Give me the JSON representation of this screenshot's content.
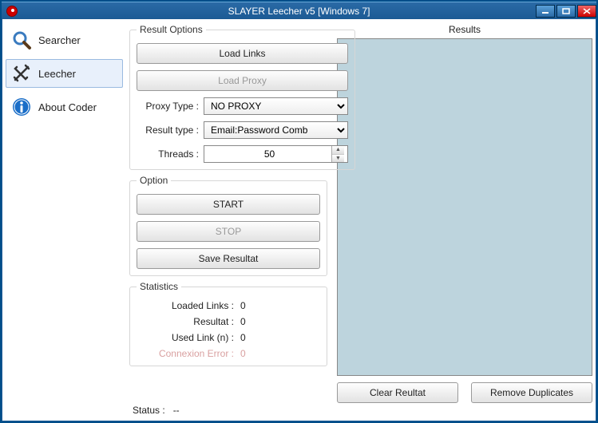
{
  "window": {
    "title": "SLAYER Leecher v5 [Windows 7]"
  },
  "sidebar": {
    "items": [
      {
        "label": "Searcher"
      },
      {
        "label": "Leecher"
      },
      {
        "label": "About Coder"
      }
    ]
  },
  "resultOptions": {
    "legend": "Result Options",
    "loadLinks": "Load Links",
    "loadProxy": "Load Proxy",
    "proxyTypeLabel": "Proxy Type :",
    "proxyTypeValue": "NO PROXY",
    "resultTypeLabel": "Result type :",
    "resultTypeValue": "Email:Password Comb",
    "threadsLabel": "Threads :",
    "threadsValue": "50"
  },
  "option": {
    "legend": "Option",
    "start": "START",
    "stop": "STOP",
    "save": "Save Resultat"
  },
  "statistics": {
    "legend": "Statistics",
    "loadedLinksLabel": "Loaded Links :",
    "loadedLinksValue": "0",
    "resultatLabel": "Resultat :",
    "resultatValue": "0",
    "usedLinkLabel": "Used Link (n) :",
    "usedLinkValue": "0",
    "connErrorLabel": "Connexion Error :",
    "connErrorValue": "0"
  },
  "results": {
    "label": "Results",
    "clear": "Clear Reultat",
    "removeDup": "Remove Duplicates"
  },
  "status": {
    "label": "Status :",
    "value": "--"
  }
}
